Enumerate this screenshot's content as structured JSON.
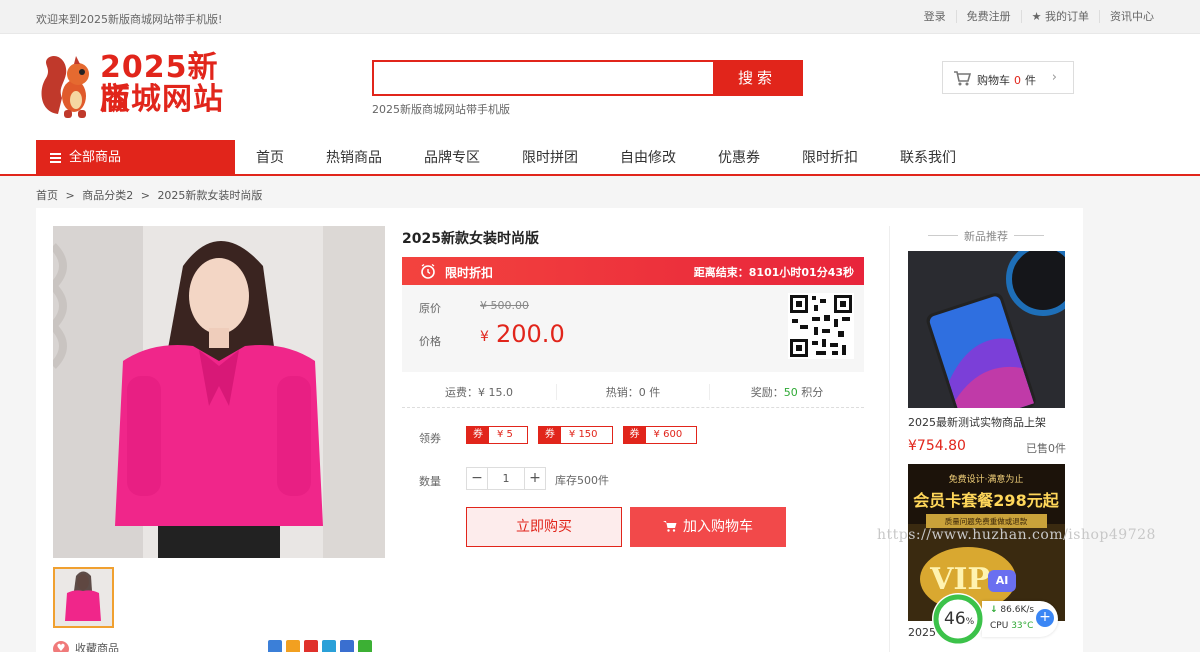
{
  "topbar": {
    "welcome": "欢迎来到2025新版商城网站带手机版!",
    "login": "登录",
    "register": "免费注册",
    "my_orders": "★ 我的订单",
    "news": "资讯中心"
  },
  "header": {
    "logo_line1": "2025新版",
    "logo_line2": "商城网站",
    "search_placeholder": "",
    "search_button": "搜索",
    "search_hint": "2025新版商城网站带手机版",
    "cart_label": "购物车",
    "cart_count": "0",
    "cart_unit": "件"
  },
  "nav": {
    "all_goods": "全部商品",
    "items": [
      "首页",
      "热销商品",
      "品牌专区",
      "限时拼团",
      "自由修改",
      "优惠券",
      "限时折扣",
      "联系我们"
    ]
  },
  "breadcrumb": [
    "首页",
    ">",
    "商品分类2",
    ">",
    "2025新款女装时尚版"
  ],
  "product": {
    "title": "2025新款女装时尚版",
    "flash_label": "限时折扣",
    "countdown": "距离结束：8101小时01分43秒",
    "orig_label": "原价",
    "orig_price": "¥ 500.00",
    "price_label": "价格",
    "currency": "¥",
    "price": "200.0",
    "shipping": "运费：¥ 15.0",
    "sales": "热销：0 件",
    "reward_prefix": "奖励：",
    "reward_points": "50",
    "reward_suffix": " 积分",
    "coupon_label": "领券",
    "coupon_tag": "券",
    "coupons": [
      "¥ 5",
      "¥ 150",
      "¥ 600"
    ],
    "qty_label": "数量",
    "qty_minus": "−",
    "qty_value": "1",
    "qty_plus": "+",
    "stock": "库存500件",
    "buy_now": "立即购买",
    "add_cart": "加入购物车",
    "favorite": "收藏商品"
  },
  "sidebar": {
    "title": "新品推荐",
    "item1_name": "2025最新测试实物商品上架",
    "item1_price": "¥754.80",
    "item1_sold": "已售0件",
    "item2_name": "2025",
    "promo_line1": "免费设计·满意为止",
    "promo_line2": "会员卡套餐298元起",
    "promo_line3": "质量问题免费重做或退款"
  },
  "overlay": {
    "watermark": "https://www.huzhan.com/ishop49728",
    "ai": "AI",
    "percent": "46",
    "percent_sign": "%",
    "net_speed": "86.6K/s",
    "cpu_label": "CPU",
    "cpu_temp": "33°C",
    "plus": "+"
  }
}
